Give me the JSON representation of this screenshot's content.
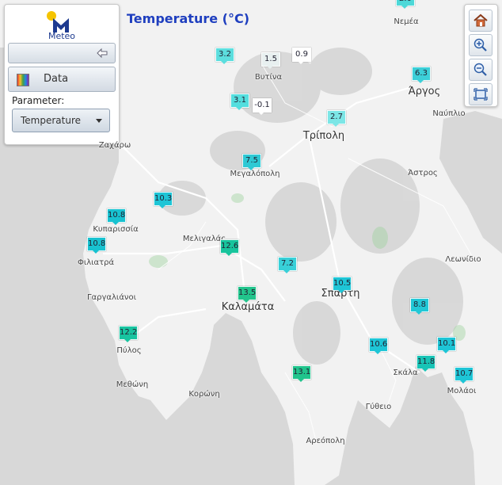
{
  "title": "Temperature (°C)",
  "panel": {
    "logo_text": "Meteo",
    "data_button": "Data",
    "parameter_label": "Parameter:",
    "parameter_value": "Temperature"
  },
  "toolbar": [
    "home-icon",
    "zoom-in-icon",
    "zoom-out-icon",
    "full-extent-icon"
  ],
  "markers": [
    {
      "value": "2.0",
      "color": "#4dd8d8"
    },
    {
      "value": "3.2",
      "color": "#5cdede"
    },
    {
      "value": "1.5",
      "color": "#e8f0f0"
    },
    {
      "value": "0.9",
      "color": "#ffffff"
    },
    {
      "value": "6.3",
      "color": "#3ccfd8"
    },
    {
      "value": "3.1",
      "color": "#54dede"
    },
    {
      "value": "-0.1",
      "color": "#ffffff"
    },
    {
      "value": "2.7",
      "color": "#7ce6e6"
    },
    {
      "value": "7.5",
      "color": "#2ec9d4"
    },
    {
      "value": "10.3",
      "color": "#1ec5d6"
    },
    {
      "value": "10.8",
      "color": "#18c2d0"
    },
    {
      "value": "10.8",
      "color": "#18c2d0"
    },
    {
      "value": "12.6",
      "color": "#18c49c"
    },
    {
      "value": "7.2",
      "color": "#38d0d8"
    },
    {
      "value": "13.5",
      "color": "#22c48c"
    },
    {
      "value": "10.5",
      "color": "#1ec5d6"
    },
    {
      "value": "8.8",
      "color": "#22c8d6"
    },
    {
      "value": "12.2",
      "color": "#18c4a0"
    },
    {
      "value": "10.6",
      "color": "#1ec5d6"
    },
    {
      "value": "10.1",
      "color": "#1ec5d6"
    },
    {
      "value": "11.8",
      "color": "#18c4b6"
    },
    {
      "value": "13.1",
      "color": "#20c48c"
    },
    {
      "value": "10.7",
      "color": "#1ec5d6"
    }
  ],
  "places": [
    "Νεμέα",
    "Βυτίνα",
    "Άργος",
    "Ναύπλιο",
    "Ζαχάρω",
    "Τρίπολη",
    "Μεγαλόπολη",
    "Άστρος",
    "Κυπαρισσία",
    "Μελιγαλάς",
    "Φιλιατρά",
    "Λεωνίδιο",
    "Γαργαλιάνοι",
    "Καλαμάτα",
    "Σπάρτη",
    "Πύλος",
    "Σκάλα",
    "Μεθώνη",
    "Κορώνη",
    "Μολάοι",
    "Γύθειο",
    "Αρεόπολη"
  ]
}
